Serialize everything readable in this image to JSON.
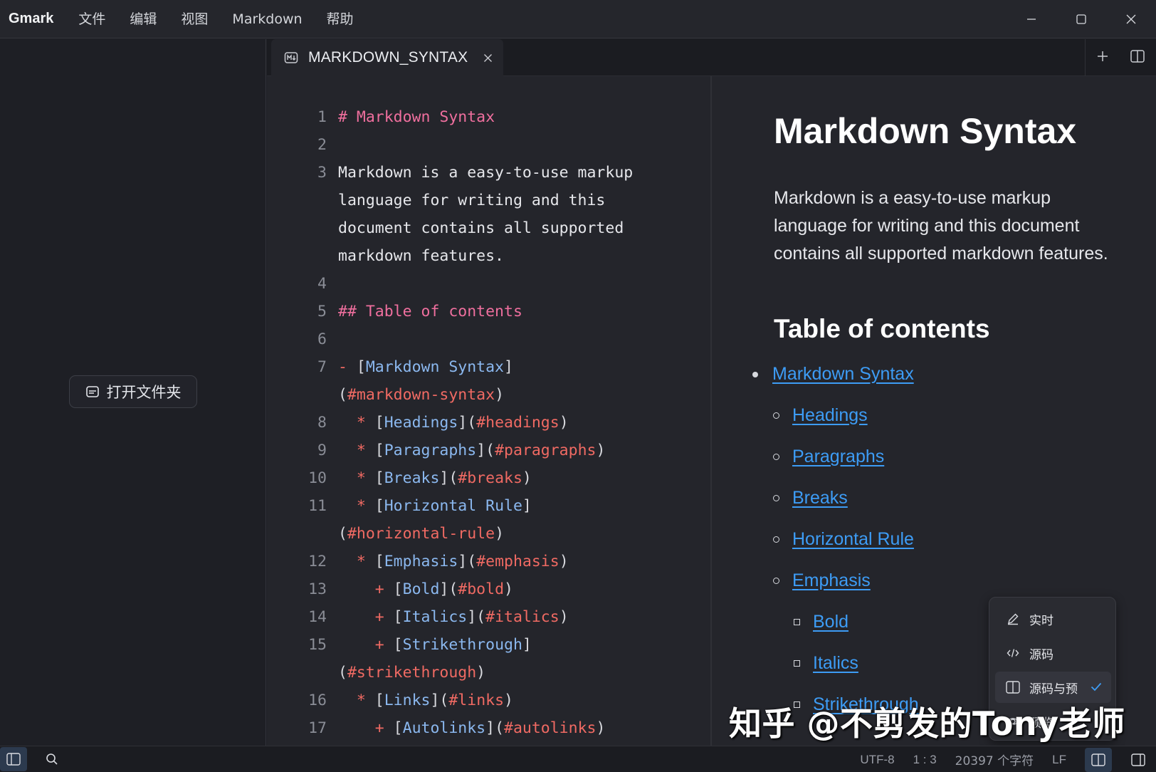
{
  "app": {
    "name": "Gmark",
    "menu": [
      "文件",
      "编辑",
      "视图",
      "Markdown",
      "帮助"
    ]
  },
  "sidebar": {
    "open_folder_label": "打开文件夹"
  },
  "tab": {
    "title": "MARKDOWN_SYNTAX"
  },
  "editor": {
    "lines": [
      {
        "n": "1",
        "parts": [
          [
            "c-head",
            "# Markdown Syntax"
          ]
        ]
      },
      {
        "n": "2",
        "parts": []
      },
      {
        "n": "3",
        "parts": [
          [
            "tx",
            "Markdown is a easy-to-use markup"
          ]
        ]
      },
      {
        "n": "",
        "parts": [
          [
            "tx",
            "language for writing and this"
          ]
        ]
      },
      {
        "n": "",
        "parts": [
          [
            "tx",
            "document contains all supported"
          ]
        ]
      },
      {
        "n": "",
        "parts": [
          [
            "tx",
            "markdown features."
          ]
        ]
      },
      {
        "n": "4",
        "parts": []
      },
      {
        "n": "5",
        "parts": [
          [
            "c-head",
            "## Table of contents"
          ]
        ]
      },
      {
        "n": "6",
        "parts": []
      },
      {
        "n": "7",
        "parts": [
          [
            "c-mark",
            "- "
          ],
          [
            "c-pun",
            "["
          ],
          [
            "c-link",
            "Markdown Syntax"
          ],
          [
            "c-pun",
            "]"
          ]
        ]
      },
      {
        "n": "",
        "parts": [
          [
            "c-pun",
            "("
          ],
          [
            "c-url",
            "#markdown-syntax"
          ],
          [
            "c-pun",
            ")"
          ]
        ]
      },
      {
        "n": "8",
        "parts": [
          [
            "c-mark",
            "  * "
          ],
          [
            "c-pun",
            "["
          ],
          [
            "c-link",
            "Headings"
          ],
          [
            "c-pun",
            "]("
          ],
          [
            "c-url",
            "#headings"
          ],
          [
            "c-pun",
            ")"
          ]
        ]
      },
      {
        "n": "9",
        "parts": [
          [
            "c-mark",
            "  * "
          ],
          [
            "c-pun",
            "["
          ],
          [
            "c-link",
            "Paragraphs"
          ],
          [
            "c-pun",
            "]("
          ],
          [
            "c-url",
            "#paragraphs"
          ],
          [
            "c-pun",
            ")"
          ]
        ]
      },
      {
        "n": "10",
        "parts": [
          [
            "c-mark",
            "  * "
          ],
          [
            "c-pun",
            "["
          ],
          [
            "c-link",
            "Breaks"
          ],
          [
            "c-pun",
            "]("
          ],
          [
            "c-url",
            "#breaks"
          ],
          [
            "c-pun",
            ")"
          ]
        ]
      },
      {
        "n": "11",
        "parts": [
          [
            "c-mark",
            "  * "
          ],
          [
            "c-pun",
            "["
          ],
          [
            "c-link",
            "Horizontal Rule"
          ],
          [
            "c-pun",
            "]"
          ]
        ]
      },
      {
        "n": "",
        "parts": [
          [
            "c-pun",
            "("
          ],
          [
            "c-url",
            "#horizontal-rule"
          ],
          [
            "c-pun",
            ")"
          ]
        ]
      },
      {
        "n": "12",
        "parts": [
          [
            "c-mark",
            "  * "
          ],
          [
            "c-pun",
            "["
          ],
          [
            "c-link",
            "Emphasis"
          ],
          [
            "c-pun",
            "]("
          ],
          [
            "c-url",
            "#emphasis"
          ],
          [
            "c-pun",
            ")"
          ]
        ]
      },
      {
        "n": "13",
        "parts": [
          [
            "c-mark",
            "    + "
          ],
          [
            "c-pun",
            "["
          ],
          [
            "c-link",
            "Bold"
          ],
          [
            "c-pun",
            "]("
          ],
          [
            "c-url",
            "#bold"
          ],
          [
            "c-pun",
            ")"
          ]
        ]
      },
      {
        "n": "14",
        "parts": [
          [
            "c-mark",
            "    + "
          ],
          [
            "c-pun",
            "["
          ],
          [
            "c-link",
            "Italics"
          ],
          [
            "c-pun",
            "]("
          ],
          [
            "c-url",
            "#italics"
          ],
          [
            "c-pun",
            ")"
          ]
        ]
      },
      {
        "n": "15",
        "parts": [
          [
            "c-mark",
            "    + "
          ],
          [
            "c-pun",
            "["
          ],
          [
            "c-link",
            "Strikethrough"
          ],
          [
            "c-pun",
            "]"
          ]
        ]
      },
      {
        "n": "",
        "parts": [
          [
            "c-pun",
            "("
          ],
          [
            "c-url",
            "#strikethrough"
          ],
          [
            "c-pun",
            ")"
          ]
        ]
      },
      {
        "n": "16",
        "parts": [
          [
            "c-mark",
            "  * "
          ],
          [
            "c-pun",
            "["
          ],
          [
            "c-link",
            "Links"
          ],
          [
            "c-pun",
            "]("
          ],
          [
            "c-url",
            "#links"
          ],
          [
            "c-pun",
            ")"
          ]
        ]
      },
      {
        "n": "17",
        "parts": [
          [
            "c-mark",
            "    + "
          ],
          [
            "c-pun",
            "["
          ],
          [
            "c-link",
            "Autolinks"
          ],
          [
            "c-pun",
            "]("
          ],
          [
            "c-url",
            "#autolinks"
          ],
          [
            "c-pun",
            ")"
          ]
        ]
      }
    ]
  },
  "preview": {
    "h1": "Markdown Syntax",
    "paragraph": "Markdown is a easy-to-use markup language for writing and this document contains all supported markdown features.",
    "h2": "Table of contents",
    "toc": [
      {
        "label": "Markdown Syntax",
        "level": 1
      },
      {
        "label": "Headings",
        "level": 2
      },
      {
        "label": "Paragraphs",
        "level": 2
      },
      {
        "label": "Breaks",
        "level": 2
      },
      {
        "label": "Horizontal Rule",
        "level": 2
      },
      {
        "label": "Emphasis",
        "level": 2
      },
      {
        "label": "Bold",
        "level": 3
      },
      {
        "label": "Italics",
        "level": 3
      },
      {
        "label": "Strikethrough",
        "level": 3
      }
    ]
  },
  "view_menu": {
    "items": [
      {
        "label": "实时",
        "icon": "pencil-icon",
        "selected": false
      },
      {
        "label": "源码",
        "icon": "code-icon",
        "selected": false
      },
      {
        "label": "源码与预",
        "icon": "split-view-icon",
        "selected": true
      },
      {
        "label": "预览",
        "icon": "eye-icon",
        "selected": false
      }
    ],
    "check_color": "#3d9cf5"
  },
  "watermark": "知乎 @不剪发的Tony老师",
  "statusbar": {
    "encoding": "UTF-8",
    "cursor": "1 : 3",
    "char_count": "20397 个字符",
    "line_ending": "LF"
  },
  "colors": {
    "accent": "#3d9cf5",
    "heading_md": "#ef6f9e",
    "url_md": "#f06a63",
    "link_text_md": "#8bb8ef"
  }
}
